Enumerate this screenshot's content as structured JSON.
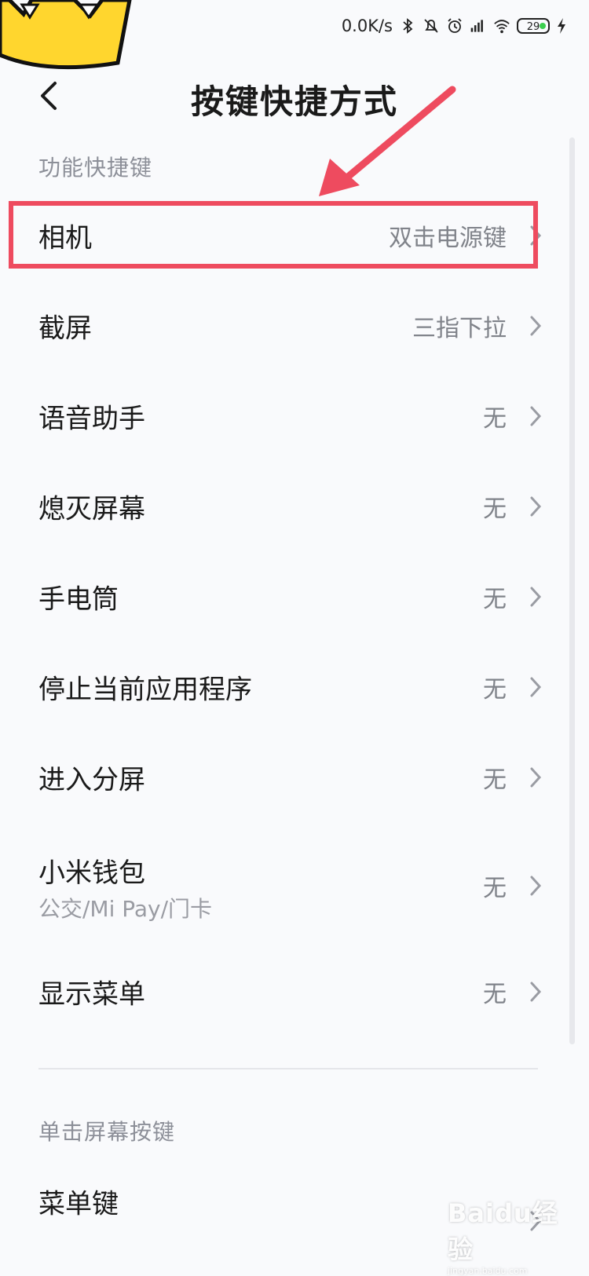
{
  "status_bar": {
    "speed": "0.0K/s",
    "battery": "29"
  },
  "header": {
    "title": "按键快捷方式"
  },
  "sections": [
    {
      "title": "功能快捷键"
    },
    {
      "title": "单击屏幕按键"
    }
  ],
  "rows": [
    {
      "label": "相机",
      "value": "双击电源键"
    },
    {
      "label": "截屏",
      "value": "三指下拉"
    },
    {
      "label": "语音助手",
      "value": "无"
    },
    {
      "label": "熄灭屏幕",
      "value": "无"
    },
    {
      "label": "手电筒",
      "value": "无"
    },
    {
      "label": "停止当前应用程序",
      "value": "无"
    },
    {
      "label": "进入分屏",
      "value": "无"
    },
    {
      "label": "小米钱包",
      "sub": "公交/Mi Pay/门卡",
      "value": "无"
    },
    {
      "label": "显示菜单",
      "value": "无"
    },
    {
      "label": "菜单键"
    }
  ],
  "colors": {
    "annotation": "#ee4b5f",
    "background": "#f9fafc"
  },
  "watermark": {
    "logo": "Baidu经验",
    "url": "jingyan.baidu.com"
  }
}
